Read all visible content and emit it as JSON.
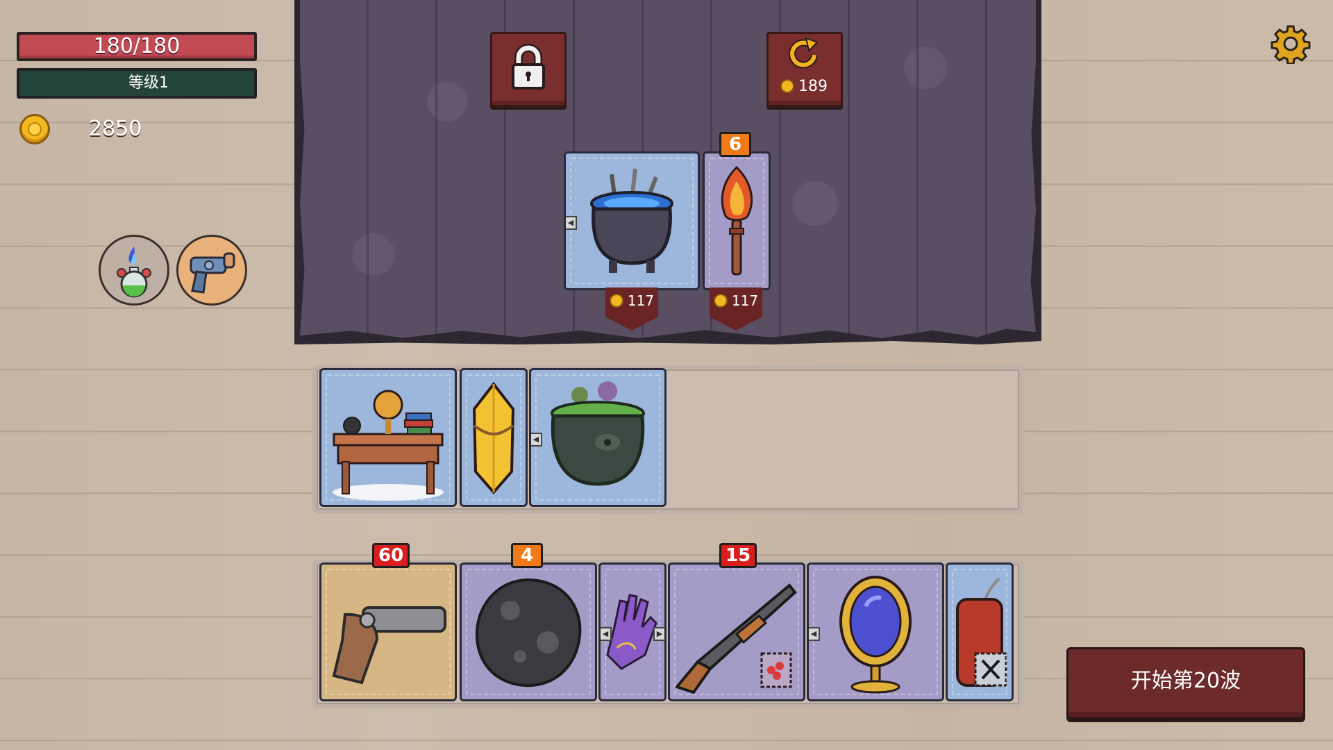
{
  "hud": {
    "hp_text": "180/180",
    "level_text": "等级1",
    "gold": "2850"
  },
  "relics": [
    {
      "name": "blue-flame-potion-icon"
    },
    {
      "name": "cork-pistol-icon"
    }
  ],
  "shop": {
    "reroll_cost": "189",
    "items": [
      {
        "name": "weapon-cauldron",
        "price": "117",
        "badge": ""
      },
      {
        "name": "phoenix-torch",
        "price": "117",
        "badge": "6"
      }
    ]
  },
  "stash": {
    "items": [
      "alchemy-table",
      "gold-crystal",
      "green-cauldron"
    ]
  },
  "hand": {
    "items": [
      {
        "name": "flintlock-pistol",
        "badge": "60"
      },
      {
        "name": "meteor-rock",
        "badge": "4"
      },
      {
        "name": "purple-glove",
        "badge": ""
      },
      {
        "name": "shotgun",
        "badge": "15"
      },
      {
        "name": "golden-mirror",
        "badge": ""
      },
      {
        "name": "dynamite",
        "badge": ""
      }
    ]
  },
  "start_button": "开始第20波",
  "colors": {
    "hp": "#c24a55",
    "level": "#24433a",
    "button": "#6c2a2a",
    "badge_orange": "#f07a16",
    "badge_red": "#d91e1e"
  }
}
